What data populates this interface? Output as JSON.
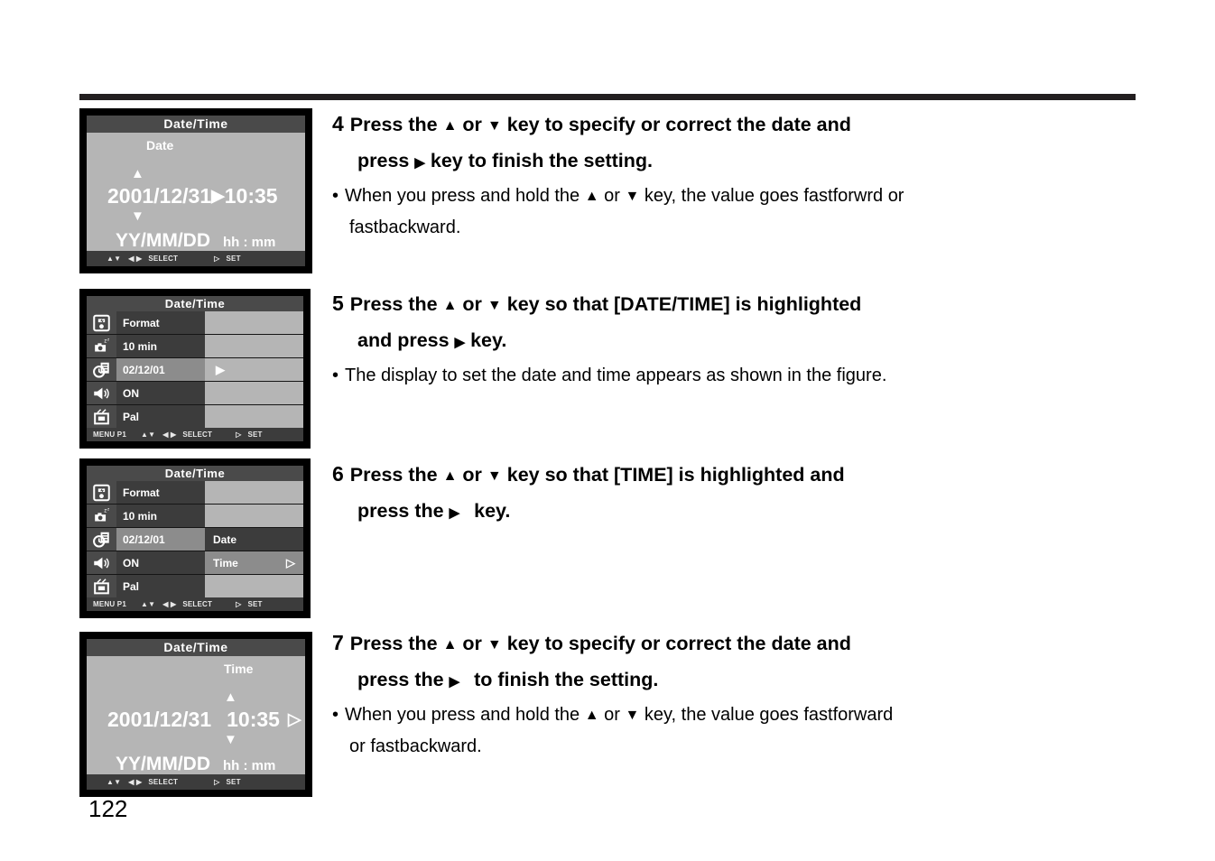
{
  "page": {
    "number": "122"
  },
  "screens": [
    {
      "id": "date-entry",
      "title": "Date/Time",
      "mode_label": "Date",
      "date_value": "2001/12/31",
      "separator_icon": "caret-right-icon",
      "time_value": "10:35",
      "date_format": "YY/MM/DD",
      "time_format": "hh : mm",
      "up_arrow": "▲",
      "down_arrow": "▼",
      "footer": {
        "menu": "",
        "updown_glyph": "▲▼",
        "leftright_glyph": "◀ ▶",
        "select_label": "SELECT",
        "set_glyph": "▷",
        "set_label": "SET"
      }
    },
    {
      "id": "menu-date-highlighted",
      "title": "Date/Time",
      "rows": [
        {
          "icon": "format-card-icon",
          "value": "Format",
          "right": "",
          "value_selected": false,
          "right_state": "blank"
        },
        {
          "icon": "camera-sleep-icon",
          "value": "10 min",
          "right": "",
          "value_selected": false,
          "right_state": "blank"
        },
        {
          "icon": "clock-date-icon",
          "value": "02/12/01",
          "right": "",
          "value_selected": true,
          "right_state": "blank"
        },
        {
          "icon": "speaker-icon",
          "value": "ON",
          "right": "",
          "value_selected": false,
          "right_state": "blank"
        },
        {
          "icon": "tv-icon",
          "value": "Pal",
          "right": "",
          "value_selected": false,
          "right_state": "blank"
        }
      ],
      "right_pointer": "▶",
      "footer": {
        "menu": "MENU P1",
        "updown_glyph": "▲▼",
        "leftright_glyph": "◀ ▶",
        "select_label": "SELECT",
        "set_glyph": "▷",
        "set_label": "SET"
      }
    },
    {
      "id": "menu-time-highlighted",
      "title": "Date/Time",
      "rows": [
        {
          "icon": "format-card-icon",
          "value": "Format",
          "right": "",
          "value_selected": false,
          "right_state": "blank"
        },
        {
          "icon": "camera-sleep-icon",
          "value": "10 min",
          "right": "",
          "value_selected": false,
          "right_state": "blank"
        },
        {
          "icon": "clock-date-icon",
          "value": "02/12/01",
          "right": "Date",
          "value_selected": true,
          "right_state": "dark"
        },
        {
          "icon": "speaker-icon",
          "value": "ON",
          "right": "Time",
          "value_selected": false,
          "right_state": "sel"
        },
        {
          "icon": "tv-icon",
          "value": "Pal",
          "right": "",
          "value_selected": false,
          "right_state": "blank"
        }
      ],
      "right_pointer": "▷",
      "footer": {
        "menu": "MENU P1",
        "updown_glyph": "▲▼",
        "leftright_glyph": "◀ ▶",
        "select_label": "SELECT",
        "set_glyph": "▷",
        "set_label": "SET"
      }
    },
    {
      "id": "time-entry",
      "title": "Date/Time",
      "mode_label": "Time",
      "date_value": "2001/12/31",
      "separator_icon": "caret-right-icon",
      "time_value": "10:35",
      "date_format": "YY/MM/DD",
      "time_format": "hh : mm",
      "up_arrow": "▲",
      "down_arrow": "▼",
      "footer": {
        "menu": "",
        "updown_glyph": "▲▼",
        "leftright_glyph": "◀ ▶",
        "select_label": "SELECT",
        "set_glyph": "▷",
        "set_label": "SET"
      }
    }
  ],
  "steps": [
    {
      "number": "4",
      "head_part1": "Press the",
      "head_up": "▲",
      "head_or": "or",
      "head_down": "▼",
      "head_part2": "key to specify or correct the date and",
      "head_line2_part1": "press",
      "head_line2_right": "▶",
      "head_line2_part2": "key  to finish the setting.",
      "bullet_dot": "•",
      "bullet_part1": "When you press and hold the",
      "bullet_up": "▲",
      "bullet_or": "or",
      "bullet_down": "▼",
      "bullet_part2": "key, the value goes fastforwrd or",
      "bullet_line2": "fastbackward."
    },
    {
      "number": "5",
      "head_part1": "Press the",
      "head_up": "▲",
      "head_or": "or",
      "head_down": "▼",
      "head_part2": "key so that [DATE/TIME] is highlighted",
      "head_line2_part1": "and press",
      "head_line2_right": "▶",
      "head_line2_part2": "key.",
      "bullet_dot": "•",
      "bullet_part1": "The display to set the date and time appears as shown in the figure.",
      "bullet_up": "",
      "bullet_or": "",
      "bullet_down": "",
      "bullet_part2": "",
      "bullet_line2": ""
    },
    {
      "number": "6",
      "head_part1": "Press the",
      "head_up": "▲",
      "head_or": "or",
      "head_down": "▼",
      "head_part2": "key so that [TIME] is highlighted and",
      "head_line2_part1": "press the",
      "head_line2_right": "▶",
      "head_line2_part2": "key.",
      "bullet_dot": "",
      "bullet_part1": "",
      "bullet_up": "",
      "bullet_or": "",
      "bullet_down": "",
      "bullet_part2": "",
      "bullet_line2": ""
    },
    {
      "number": "7",
      "head_part1": "Press the",
      "head_up": "▲",
      "head_or": "or",
      "head_down": "▼",
      "head_part2": "key to specify or correct the date and",
      "head_line2_part1": "press the",
      "head_line2_right": "▶",
      "head_line2_part2": "to finish the setting.",
      "bullet_dot": "•",
      "bullet_part1": "When you press and hold the",
      "bullet_up": "▲",
      "bullet_or": "or",
      "bullet_down": "▼",
      "bullet_part2": "key, the value goes fastforward",
      "bullet_line2": "or fastbackward."
    }
  ],
  "colors": {
    "ink": "#231f20",
    "lcd_bg": "#b5b5b5",
    "lcd_title_bar": "#4a4a4a",
    "lcd_row_dark": "#3c3c3c",
    "lcd_row_selected": "#8c8c8c",
    "frame": "#000000"
  }
}
